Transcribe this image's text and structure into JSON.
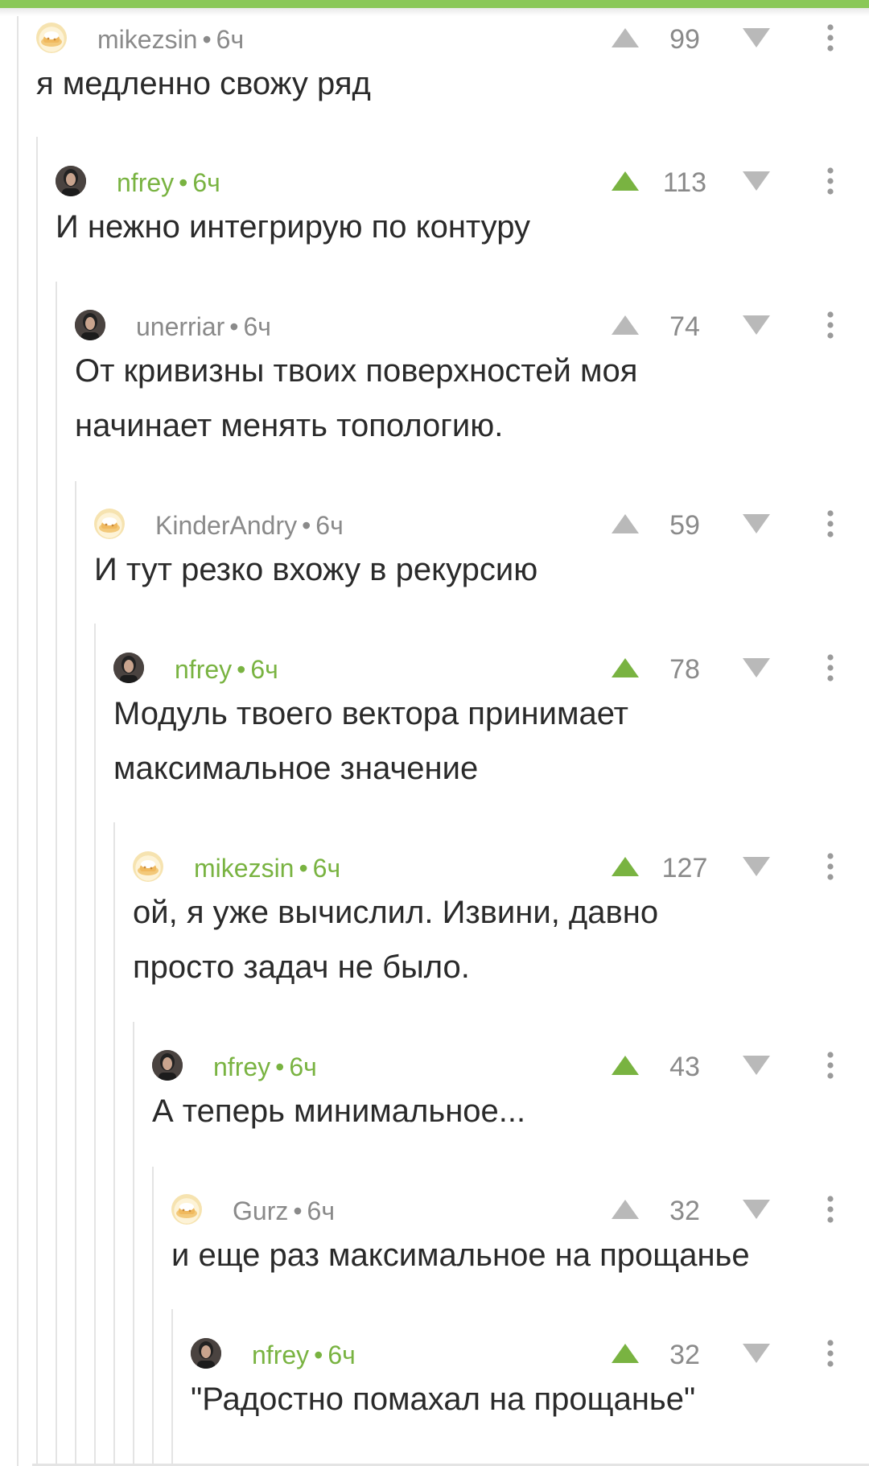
{
  "colors": {
    "accent": "#8ac858",
    "upvote_active": "#79b341",
    "muted": "#8a8a8a",
    "text": "#2a2a2a"
  },
  "comments": [
    {
      "author": "mikezsin",
      "time": "6ч",
      "rating": "99",
      "upvoted": false,
      "text_lines": [
        "я медленно свожу ряд"
      ],
      "avatar": "egg-avatar"
    },
    {
      "author": "nfrey",
      "time": "6ч",
      "rating": "113",
      "upvoted": true,
      "text_lines": [
        "И нежно интегрирую по контуру"
      ],
      "avatar": "photo-avatar"
    },
    {
      "author": "unerriar",
      "time": "6ч",
      "rating": "74",
      "upvoted": false,
      "text_lines": [
        "От кривизны твоих поверхностей моя",
        "начинает менять топологию."
      ],
      "avatar": "photo-avatar"
    },
    {
      "author": "KinderAndry",
      "time": "6ч",
      "rating": "59",
      "upvoted": false,
      "text_lines": [
        "И тут резко вхожу в рекурсию"
      ],
      "avatar": "egg-avatar"
    },
    {
      "author": "nfrey",
      "time": "6ч",
      "rating": "78",
      "upvoted": true,
      "text_lines": [
        "Модуль твоего вектора принимает",
        "максимальное значение"
      ],
      "avatar": "photo-avatar"
    },
    {
      "author": "mikezsin",
      "time": "6ч",
      "rating": "127",
      "upvoted": true,
      "text_lines": [
        "ой, я уже вычислил. Извини, давно",
        "просто задач не было."
      ],
      "avatar": "egg-avatar"
    },
    {
      "author": "nfrey",
      "time": "6ч",
      "rating": "43",
      "upvoted": true,
      "text_lines": [
        "А теперь минимальное..."
      ],
      "avatar": "photo-avatar"
    },
    {
      "author": "Gurz",
      "time": "6ч",
      "rating": "32",
      "upvoted": false,
      "text_lines": [
        "и еще раз максимальное на прощанье"
      ],
      "avatar": "egg-avatar"
    },
    {
      "author": "nfrey",
      "time": "6ч",
      "rating": "32",
      "upvoted": true,
      "text_lines": [
        "\"Радостно помахал на прощанье\""
      ],
      "avatar": "photo-avatar"
    }
  ]
}
